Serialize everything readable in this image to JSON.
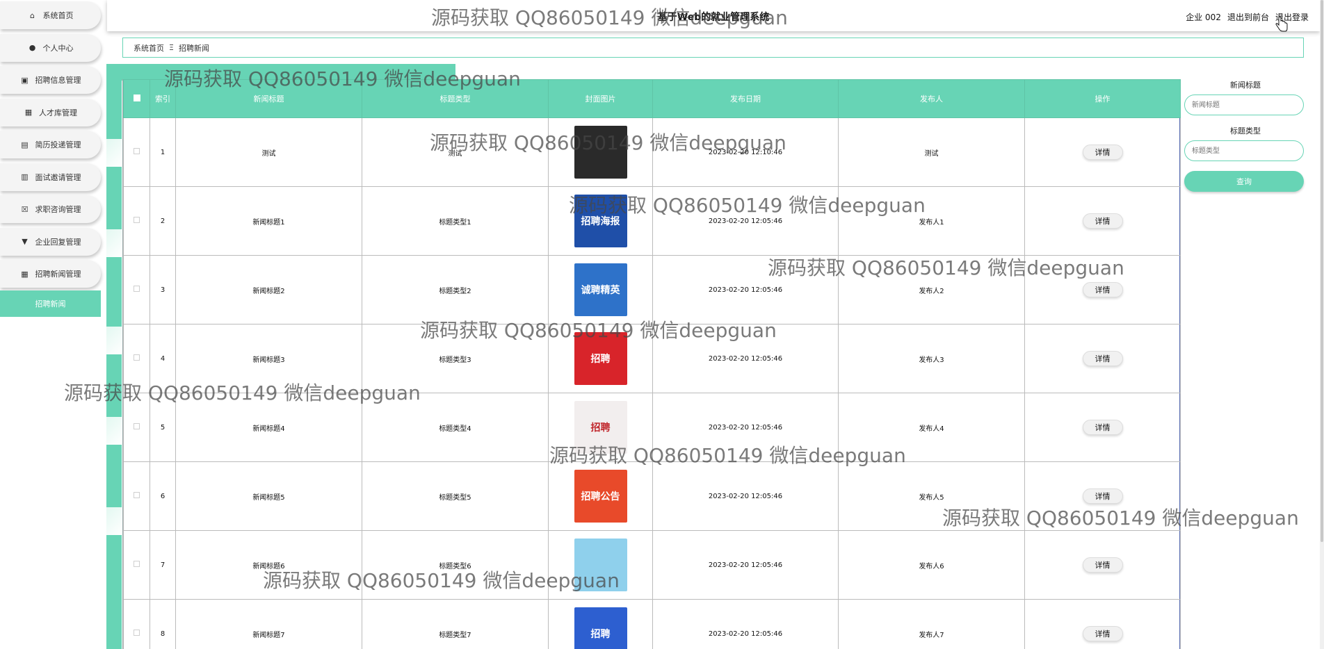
{
  "header": {
    "title": "基于Web的就业管理系统",
    "user": "企业 002",
    "to_front": "退出到前台",
    "logout": "退出登录"
  },
  "sidebar": {
    "items": [
      {
        "label": "系统首页",
        "icon": "home-icon"
      },
      {
        "label": "个人中心",
        "icon": "user-icon"
      },
      {
        "label": "招聘信息管理",
        "icon": "briefcase-icon"
      },
      {
        "label": "人才库管理",
        "icon": "grid-icon"
      },
      {
        "label": "简历投递管理",
        "icon": "document-icon"
      },
      {
        "label": "面试邀请管理",
        "icon": "calendar-icon"
      },
      {
        "label": "求职咨询管理",
        "icon": "close-box-icon"
      },
      {
        "label": "企业回复管理",
        "icon": "pin-icon"
      },
      {
        "label": "招聘新闻管理",
        "icon": "grid-icon"
      }
    ],
    "sub_item": "招聘新闻"
  },
  "breadcrumb": {
    "home": "系统首页",
    "separator": "Ξ",
    "current": "招聘新闻"
  },
  "table": {
    "columns": [
      "",
      "索引",
      "新闻标题",
      "标题类型",
      "封面图片",
      "发布日期",
      "发布人",
      "操作"
    ],
    "action_label": "详情",
    "rows": [
      {
        "index": "1",
        "title": "测试",
        "type": "测试",
        "date": "2023-02-20 12:10:46",
        "publisher": "测试",
        "cover": {
          "text": "",
          "color": "#2a2a2a"
        }
      },
      {
        "index": "2",
        "title": "新闻标题1",
        "type": "标题类型1",
        "date": "2023-02-20 12:05:46",
        "publisher": "发布人1",
        "cover": {
          "text": "招聘海报",
          "color": "#1f4fa8"
        }
      },
      {
        "index": "3",
        "title": "新闻标题2",
        "type": "标题类型2",
        "date": "2023-02-20 12:05:46",
        "publisher": "发布人2",
        "cover": {
          "text": "诚聘精英",
          "color": "#2e72c9"
        }
      },
      {
        "index": "4",
        "title": "新闻标题3",
        "type": "标题类型3",
        "date": "2023-02-20 12:05:46",
        "publisher": "发布人3",
        "cover": {
          "text": "招聘",
          "color": "#d8242a"
        }
      },
      {
        "index": "5",
        "title": "新闻标题4",
        "type": "标题类型4",
        "date": "2023-02-20 12:05:46",
        "publisher": "发布人4",
        "cover": {
          "text": "招聘",
          "color": "#f2eeee"
        }
      },
      {
        "index": "6",
        "title": "新闻标题5",
        "type": "标题类型5",
        "date": "2023-02-20 12:05:46",
        "publisher": "发布人5",
        "cover": {
          "text": "招聘公告",
          "color": "#e84a2a"
        }
      },
      {
        "index": "7",
        "title": "新闻标题6",
        "type": "标题类型6",
        "date": "2023-02-20 12:05:46",
        "publisher": "发布人6",
        "cover": {
          "text": "",
          "color": "#8fd0ec"
        }
      },
      {
        "index": "8",
        "title": "新闻标题7",
        "type": "标题类型7",
        "date": "2023-02-20 12:05:46",
        "publisher": "发布人7",
        "cover": {
          "text": "招聘",
          "color": "#2d5fd0"
        }
      }
    ]
  },
  "search": {
    "title_label": "新闻标题",
    "title_placeholder": "新闻标题",
    "type_label": "标题类型",
    "type_placeholder": "标题类型",
    "button": "查询"
  },
  "watermark": "源码获取 QQ86050149 微信deepguan"
}
